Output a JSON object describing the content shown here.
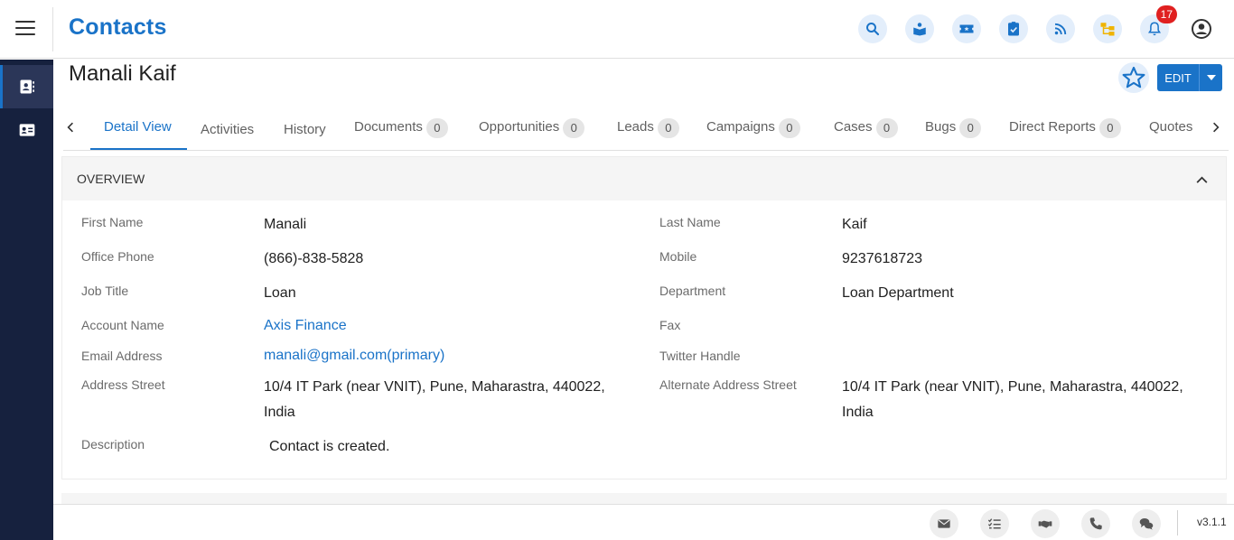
{
  "header": {
    "module_title": "Contacts",
    "notification_count": "17",
    "icons": [
      "search-icon",
      "book-icon",
      "ticket-icon",
      "task-check-icon",
      "rss-icon",
      "sitemap-icon",
      "bell-icon",
      "user-account-icon"
    ]
  },
  "sidebar": {
    "items": [
      {
        "icon": "contact-card-icon",
        "active": true
      },
      {
        "icon": "id-card-icon",
        "active": false
      }
    ]
  },
  "record": {
    "name": "Manali Kaif",
    "edit_label": "EDIT"
  },
  "tabs": [
    {
      "label": "Detail View",
      "count": null,
      "active": true
    },
    {
      "label": "Activities",
      "count": null
    },
    {
      "label": "History",
      "count": null
    },
    {
      "label": "Documents",
      "count": "0"
    },
    {
      "label": "Opportunities",
      "count": "0"
    },
    {
      "label": "Leads",
      "count": "0"
    },
    {
      "label": "Campaigns",
      "count": "0"
    },
    {
      "label": "Cases",
      "count": "0"
    },
    {
      "label": "Bugs",
      "count": "0"
    },
    {
      "label": "Direct Reports",
      "count": "0"
    },
    {
      "label": "Quotes",
      "count": null
    }
  ],
  "overview": {
    "title": "OVERVIEW",
    "fields": {
      "first_name": {
        "label": "First Name",
        "value": "Manali"
      },
      "last_name": {
        "label": "Last Name",
        "value": "Kaif"
      },
      "office_phone": {
        "label": "Office Phone",
        "value": "(866)-838-5828"
      },
      "mobile": {
        "label": "Mobile",
        "value": "9237618723"
      },
      "job_title": {
        "label": "Job Title",
        "value": "Loan"
      },
      "department": {
        "label": "Department",
        "value": "Loan Department"
      },
      "account_name": {
        "label": "Account Name",
        "value": "Axis Finance"
      },
      "fax": {
        "label": "Fax",
        "value": ""
      },
      "email": {
        "label": "Email Address",
        "value": "manali@gmail.com(primary)"
      },
      "twitter": {
        "label": "Twitter Handle",
        "value": ""
      },
      "address_street": {
        "label": "Address Street",
        "value_line1": "10/4 IT Park (near VNIT), Pune, Maharastra, 440022,",
        "value_line2": "India"
      },
      "alt_address_street": {
        "label": "Alternate Address Street",
        "value_line1": "10/4 IT Park (near VNIT), Pune, Maharastra, 440022,",
        "value_line2": "India"
      },
      "description": {
        "label": "Description",
        "value": "Contact is created."
      }
    }
  },
  "footer": {
    "icons": [
      "email-icon",
      "tasks-list-icon",
      "meeting-handshake-icon",
      "phone-icon",
      "chat-icon"
    ],
    "version": "v3.1.1"
  },
  "colors": {
    "accent": "#1a73c8",
    "sidebar_bg": "#16213e",
    "badge": "#e02020"
  }
}
